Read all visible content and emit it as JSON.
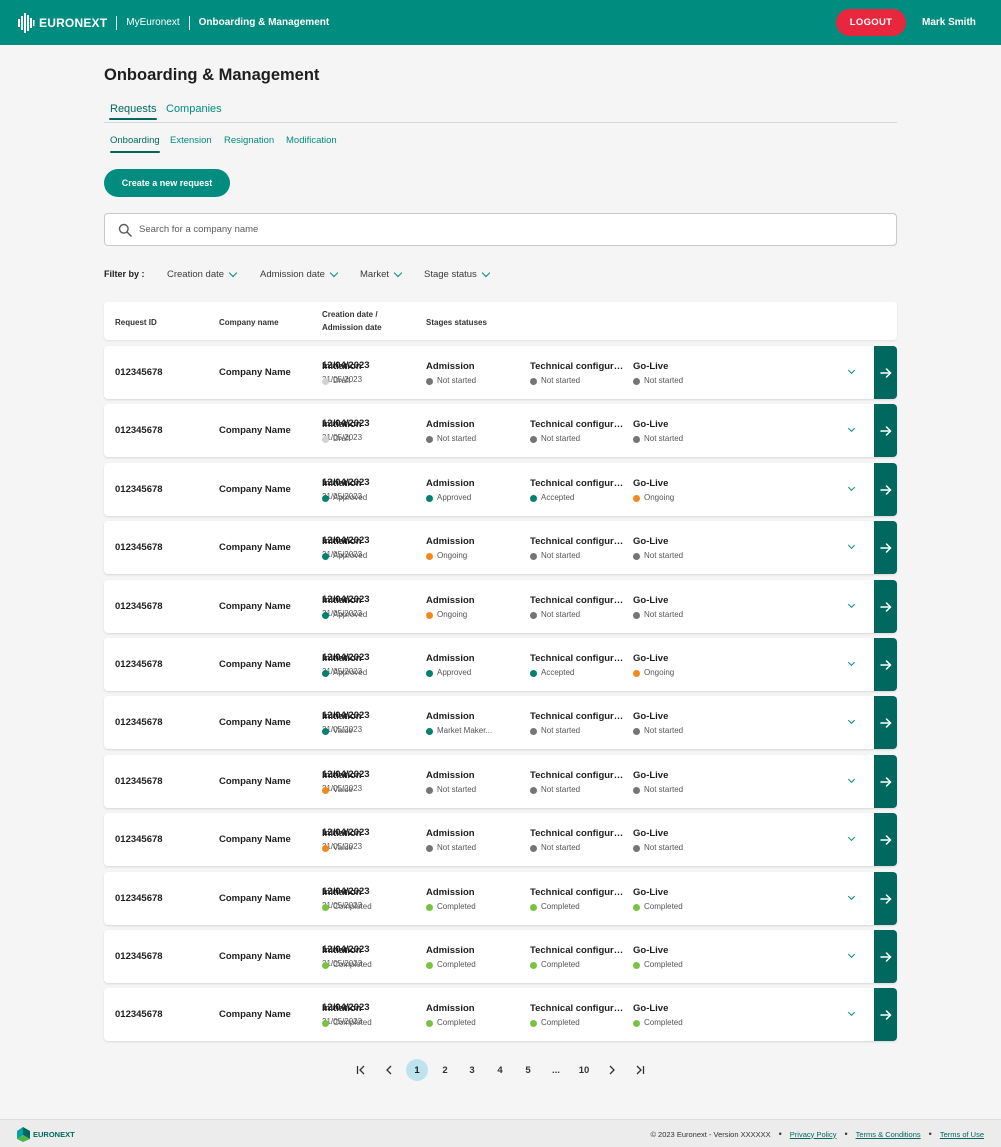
{
  "header": {
    "brand": "EURONEXT",
    "my_link": "MyEuronext",
    "section_link": "Onboarding & Management",
    "logout_label": "LOGOUT",
    "user_name": "Mark Smith"
  },
  "page": {
    "title": "Onboarding & Management",
    "tabs": [
      {
        "label": "Requests",
        "active": true
      },
      {
        "label": "Companies",
        "active": false
      }
    ],
    "subtabs": [
      {
        "label": "Onboarding",
        "active": true
      },
      {
        "label": "Extension",
        "active": false
      },
      {
        "label": "Resignation",
        "active": false
      },
      {
        "label": "Modification",
        "active": false
      }
    ],
    "create_label": "Create a new request",
    "search_placeholder": "Search for a company name",
    "filter_label": "Filter by :",
    "filters": [
      "Creation date",
      "Admission date",
      "Market",
      "Stage status"
    ]
  },
  "table": {
    "headers": {
      "request_id": "Request ID",
      "company": "Company name",
      "dates_line1": "Creation date /",
      "dates_line2": "Admission date",
      "stages": "Stages statuses"
    },
    "rows": [
      {
        "id": "012345678",
        "company": "Company Name",
        "created": "12/04/2023",
        "admission": "21/05/2023",
        "stages": [
          {
            "name": "Initiation",
            "status": "Draft",
            "color": "#d2d2d2"
          },
          {
            "name": "Admission",
            "status": "Not started",
            "color": "#757575"
          },
          {
            "name": "Technical configura...",
            "status": "Not started",
            "color": "#757575"
          },
          {
            "name": "Go-Live",
            "status": "Not started",
            "color": "#757575"
          }
        ]
      },
      {
        "id": "012345678",
        "company": "Company Name",
        "created": "12/04/2023",
        "admission": "21/05/2023",
        "stages": [
          {
            "name": "Initiation",
            "status": "Draft",
            "color": "#d2d2d2"
          },
          {
            "name": "Admission",
            "status": "Not started",
            "color": "#757575"
          },
          {
            "name": "Technical configura...",
            "status": "Not started",
            "color": "#757575"
          },
          {
            "name": "Go-Live",
            "status": "Not started",
            "color": "#757575"
          }
        ]
      },
      {
        "id": "012345678",
        "company": "Company Name",
        "created": "12/04/2023",
        "admission": "21/05/2023",
        "stages": [
          {
            "name": "Initiation",
            "status": "Approved",
            "color": "#00806f"
          },
          {
            "name": "Admission",
            "status": "Approved",
            "color": "#00806f"
          },
          {
            "name": "Technical configura...",
            "status": "Accepted",
            "color": "#00806f"
          },
          {
            "name": "Go-Live",
            "status": "Ongoing",
            "color": "#f08a1c"
          }
        ]
      },
      {
        "id": "012345678",
        "company": "Company Name",
        "created": "12/04/2023",
        "admission": "21/05/2023",
        "stages": [
          {
            "name": "Initiation",
            "status": "Approved",
            "color": "#00806f"
          },
          {
            "name": "Admission",
            "status": "Ongoing",
            "color": "#f08a1c"
          },
          {
            "name": "Technical configura...",
            "status": "Not started",
            "color": "#757575"
          },
          {
            "name": "Go-Live",
            "status": "Not started",
            "color": "#757575"
          }
        ]
      },
      {
        "id": "012345678",
        "company": "Company Name",
        "created": "12/04/2023",
        "admission": "21/05/2023",
        "stages": [
          {
            "name": "Initiation",
            "status": "Approved",
            "color": "#00806f"
          },
          {
            "name": "Admission",
            "status": "Ongoing",
            "color": "#f08a1c"
          },
          {
            "name": "Technical configura...",
            "status": "Not started",
            "color": "#757575"
          },
          {
            "name": "Go-Live",
            "status": "Not started",
            "color": "#757575"
          }
        ]
      },
      {
        "id": "012345678",
        "company": "Company Name",
        "created": "12/04/2023",
        "admission": "21/05/2023",
        "stages": [
          {
            "name": "Initiation",
            "status": "Approved",
            "color": "#00806f"
          },
          {
            "name": "Admission",
            "status": "Approved",
            "color": "#00806f"
          },
          {
            "name": "Technical configura...",
            "status": "Accepted",
            "color": "#00806f"
          },
          {
            "name": "Go-Live",
            "status": "Ongoing",
            "color": "#f08a1c"
          }
        ]
      },
      {
        "id": "012345678",
        "company": "Company Name",
        "created": "12/04/2023",
        "admission": "21/05/2023",
        "stages": [
          {
            "name": "Initiation",
            "status": "Value",
            "color": "#00806f"
          },
          {
            "name": "Admission",
            "status": "Market Maker...",
            "color": "#00806f"
          },
          {
            "name": "Technical configura...",
            "status": "Not started",
            "color": "#757575"
          },
          {
            "name": "Go-Live",
            "status": "Not started",
            "color": "#757575"
          }
        ]
      },
      {
        "id": "012345678",
        "company": "Company Name",
        "created": "12/04/2023",
        "admission": "21/05/2023",
        "stages": [
          {
            "name": "Initiation",
            "status": "Value",
            "color": "#f08a1c"
          },
          {
            "name": "Admission",
            "status": "Not started",
            "color": "#757575"
          },
          {
            "name": "Technical configura...",
            "status": "Not started",
            "color": "#757575"
          },
          {
            "name": "Go-Live",
            "status": "Not started",
            "color": "#757575"
          }
        ]
      },
      {
        "id": "012345678",
        "company": "Company Name",
        "created": "12/04/2023",
        "admission": "21/05/2023",
        "stages": [
          {
            "name": "Initiation",
            "status": "Value",
            "color": "#f08a1c"
          },
          {
            "name": "Admission",
            "status": "Not started",
            "color": "#757575"
          },
          {
            "name": "Technical configura...",
            "status": "Not started",
            "color": "#757575"
          },
          {
            "name": "Go-Live",
            "status": "Not started",
            "color": "#757575"
          }
        ]
      },
      {
        "id": "012345678",
        "company": "Company Name",
        "created": "12/04/2023",
        "admission": "21/05/2023",
        "stages": [
          {
            "name": "Initiation",
            "status": "Completed",
            "color": "#7cc242"
          },
          {
            "name": "Admission",
            "status": "Completed",
            "color": "#7cc242"
          },
          {
            "name": "Technical configura...",
            "status": "Completed",
            "color": "#7cc242"
          },
          {
            "name": "Go-Live",
            "status": "Completed",
            "color": "#7cc242"
          }
        ]
      },
      {
        "id": "012345678",
        "company": "Company Name",
        "created": "12/04/2023",
        "admission": "21/05/2023",
        "stages": [
          {
            "name": "Initiation",
            "status": "Completed",
            "color": "#7cc242"
          },
          {
            "name": "Admission",
            "status": "Completed",
            "color": "#7cc242"
          },
          {
            "name": "Technical configura...",
            "status": "Completed",
            "color": "#7cc242"
          },
          {
            "name": "Go-Live",
            "status": "Completed",
            "color": "#7cc242"
          }
        ]
      },
      {
        "id": "012345678",
        "company": "Company Name",
        "created": "12/04/2023",
        "admission": "21/05/2023",
        "stages": [
          {
            "name": "Initiation",
            "status": "Completed",
            "color": "#7cc242"
          },
          {
            "name": "Admission",
            "status": "Completed",
            "color": "#7cc242"
          },
          {
            "name": "Technical configura...",
            "status": "Completed",
            "color": "#7cc242"
          },
          {
            "name": "Go-Live",
            "status": "Completed",
            "color": "#7cc242"
          }
        ]
      }
    ]
  },
  "pagination": {
    "current": "1",
    "pages": [
      "1",
      "2",
      "3",
      "4",
      "5",
      "...",
      "10"
    ],
    "icons": [
      "first-page-icon",
      "prev-page-icon",
      "next-page-icon",
      "last-page-icon"
    ]
  },
  "footer": {
    "brand": "EURONEXT",
    "copyright": "© 2023 Euronext - Version XXXXXX",
    "links": [
      "Privacy Policy",
      "Terms & Conditions",
      "Terms of Use"
    ]
  },
  "colors": {
    "brand_green": "#008d7f",
    "dark_green": "#00685e",
    "logout_red": "#e8273f",
    "status_grey": "#757575",
    "status_draft": "#d2d2d2",
    "status_approved": "#00806f",
    "status_ongoing": "#f08a1c",
    "status_completed": "#7cc242",
    "page_active": "#bfe3ee"
  }
}
